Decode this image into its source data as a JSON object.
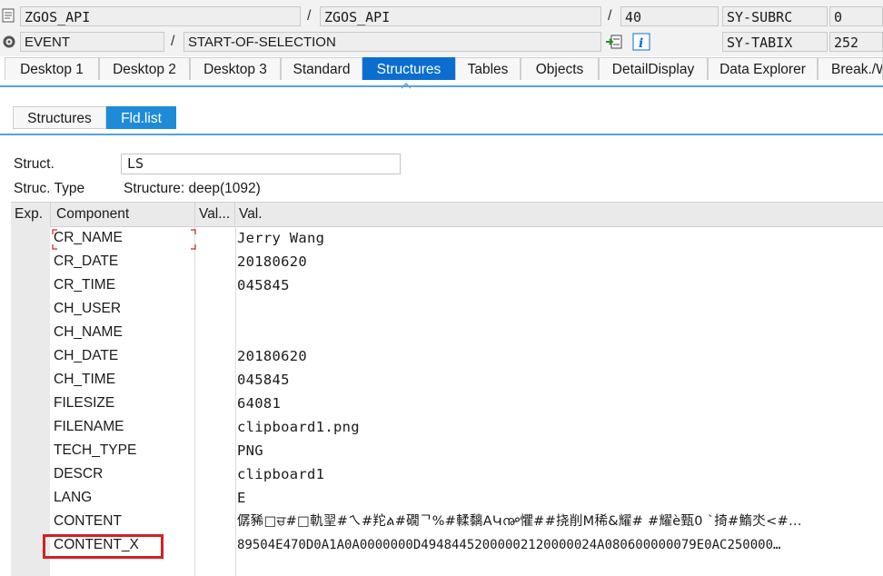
{
  "header": {
    "row1": {
      "program": "ZGOS_API",
      "include": "ZGOS_API",
      "line": "40",
      "sysvar": "SY-SUBRC",
      "sysval": "0"
    },
    "row2": {
      "event_type": "EVENT",
      "event": "START-OF-SELECTION",
      "sysvar": "SY-TABIX",
      "sysval": "252"
    },
    "separator": "/"
  },
  "tabs": [
    "Desktop 1",
    "Desktop 2",
    "Desktop 3",
    "Standard",
    "Structures",
    "Tables",
    "Objects",
    "DetailDisplay",
    "Data Explorer",
    "Break./Wat"
  ],
  "active_tab": "Structures",
  "subtabs": [
    "Structures",
    "Fld.list"
  ],
  "active_subtab": "Fld.list",
  "struct": {
    "label": "Struct.",
    "value": "LS"
  },
  "struc_type": {
    "label": "Struc. Type",
    "value": "Structure: deep(1092)"
  },
  "grid": {
    "columns": [
      "Exp.",
      "Component",
      "Val...",
      "Val."
    ],
    "rows": [
      {
        "component": "CR_NAME",
        "value": "Jerry Wang"
      },
      {
        "component": "CR_DATE",
        "value": "20180620"
      },
      {
        "component": "CR_TIME",
        "value": "045845"
      },
      {
        "component": "CH_USER",
        "value": ""
      },
      {
        "component": "CH_NAME",
        "value": ""
      },
      {
        "component": "CH_DATE",
        "value": "20180620"
      },
      {
        "component": "CH_TIME",
        "value": "045845"
      },
      {
        "component": "FILESIZE",
        "value": "64081"
      },
      {
        "component": "FILENAME",
        "value": "clipboard1.png"
      },
      {
        "component": "TECH_TYPE",
        "value": "PNG"
      },
      {
        "component": "DESCR",
        "value": "clipboard1"
      },
      {
        "component": "LANG",
        "value": "E"
      },
      {
        "component": "CONTENT",
        "value": "僝豨□ਚ#□軌䍿#ㄟ#䍫ል#礀ᄀ%#輮黐AԿ൲懼##挠削M稀&耀# #耀ѐ甄0 `掎#鰖氼<#…"
      },
      {
        "component": "CONTENT_X",
        "value": "89504E470D0A1A0A0000000D49484452000002120000024A080600000079E0AC250000…"
      }
    ]
  },
  "colors": {
    "accent": "#0a6ed1",
    "highlight": "#d42020"
  }
}
